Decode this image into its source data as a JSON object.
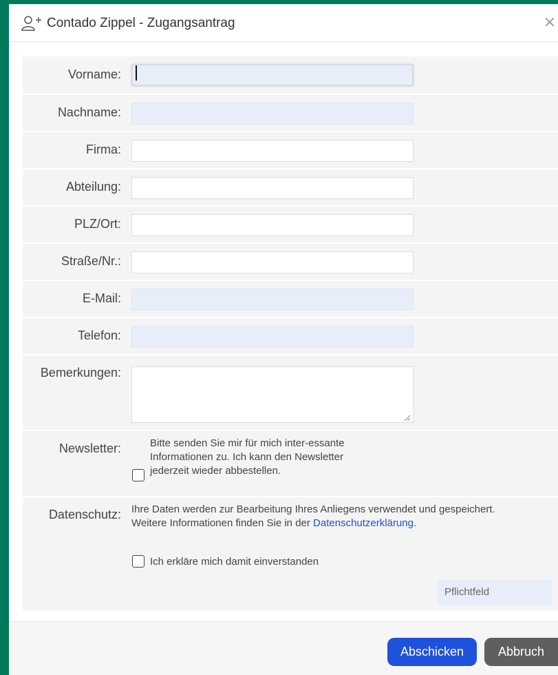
{
  "dialog": {
    "title": "Contado Zippel - Zugangsantrag",
    "title_icon": "user-add-icon",
    "close_label": "×"
  },
  "form": {
    "fields": {
      "vorname": {
        "label": "Vorname:",
        "value": "",
        "required": true
      },
      "nachname": {
        "label": "Nachname:",
        "value": "",
        "required": true
      },
      "firma": {
        "label": "Firma:",
        "value": "",
        "required": false
      },
      "abteilung": {
        "label": "Abteilung:",
        "value": "",
        "required": false
      },
      "plz_ort": {
        "label": "PLZ/Ort:",
        "value": "",
        "required": false
      },
      "strasse": {
        "label": "Straße/Nr.:",
        "value": "",
        "required": false
      },
      "email": {
        "label": "E-Mail:",
        "value": "",
        "required": true
      },
      "telefon": {
        "label": "Telefon:",
        "value": "",
        "required": true
      },
      "bemerkungen": {
        "label": "Bemerkungen:",
        "value": "",
        "required": false
      }
    },
    "newsletter": {
      "label": "Newsletter:",
      "text": "Bitte senden Sie mir für mich inter-essante Informationen zu. Ich kann den Newsletter jederzeit wieder abbestellen.",
      "checked": false
    },
    "datenschutz": {
      "label": "Datenschutz:",
      "text1": "Ihre Daten werden zur Bearbeitung Ihres Anliegens verwendet und gespeichert.",
      "text2": "Weitere Informationen finden Sie in der ",
      "link": "Datenschutzerklärung",
      "text3": ".",
      "consent_label": "Ich erkläre mich damit einverstanden",
      "checked": false
    },
    "required_legend": "Pflichtfeld"
  },
  "footer": {
    "submit_label": "Abschicken",
    "cancel_label": "Abbruch"
  },
  "colors": {
    "background": "#00795a",
    "required_field": "#e8edfa",
    "submit": "#1e52dc",
    "cancel": "#5f5f5f",
    "link": "#1f4fd8"
  }
}
